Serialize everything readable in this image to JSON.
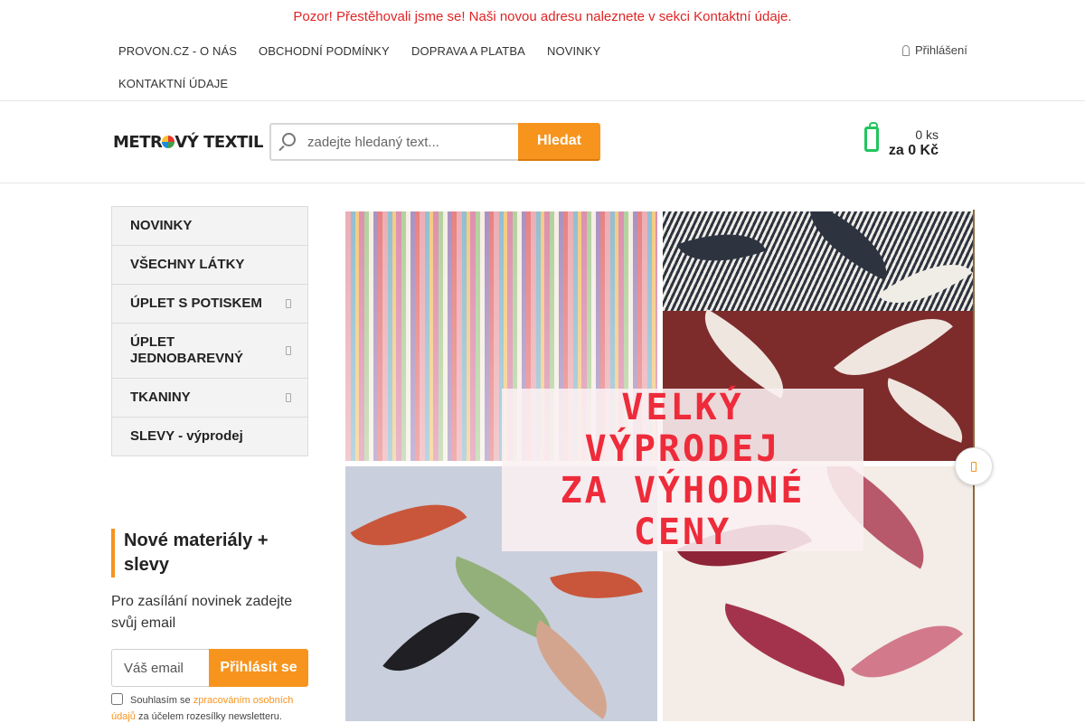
{
  "notice": "Pozor! Přestěhovali jsme se! Naši novou adresu naleznete v sekci Kontaktní údaje.",
  "topnav": {
    "items": [
      "PROVON.CZ - O NÁS",
      "OBCHODNÍ PODMÍNKY",
      "DOPRAVA A PLATBA",
      "NOVINKY",
      "KONTAKTNÍ ÚDAJE"
    ],
    "login": "Přihlášení"
  },
  "header": {
    "logo_a": "METR",
    "logo_b": "VÝ TEXTIL",
    "search_placeholder": "zadejte hledaný text...",
    "search_button": "Hledat",
    "cart_count": "0 ks",
    "cart_price": "za 0 Kč"
  },
  "sidebar": {
    "categories": [
      {
        "label": "NOVINKY",
        "has_sub": false
      },
      {
        "label": "VŠECHNY LÁTKY",
        "has_sub": false
      },
      {
        "label": "ÚPLET S POTISKEM",
        "has_sub": true
      },
      {
        "label": "ÚPLET JEDNOBAREVNÝ",
        "has_sub": true
      },
      {
        "label": "TKANINY",
        "has_sub": true
      },
      {
        "label": "SLEVY - výprodej",
        "has_sub": false
      }
    ]
  },
  "newsletter": {
    "title": "Nové materiály + slevy",
    "text": "Pro zasílání novinek zadejte svůj email",
    "email_placeholder": "Váš email",
    "button": "Přihlásit se",
    "consent_pre": "Souhlasím se",
    "consent_link": "zpracováním osobních údajů",
    "consent_post": "za účelem rozesílky newsletteru."
  },
  "banner": {
    "lines": [
      "VELKÝ",
      "VÝPRODEJ",
      "ZA VÝHODNÉ",
      "CENY"
    ]
  },
  "colors": {
    "accent": "#f7941d",
    "notice": "#e02424",
    "cart": "#22c55e",
    "sale_text": "#ee2b3a"
  }
}
